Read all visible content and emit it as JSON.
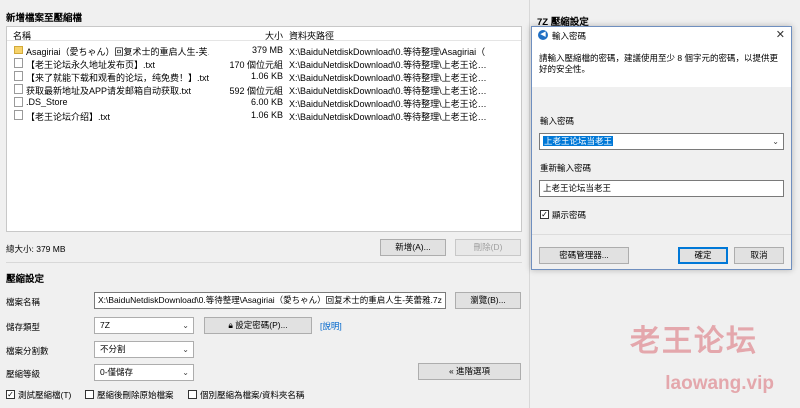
{
  "main": {
    "add_section_title": "新增檔案至壓縮檔",
    "columns": {
      "name": "名稱",
      "size": "大小",
      "path": "資料夾路徑"
    },
    "files": [
      {
        "name": "Asagiriai（愛ちゃん）回复术士的重启人生-芙…",
        "size": "379 MB",
        "path": "X:\\BaiduNetdiskDownload\\0.等待整理\\Asagiriai（",
        "icon": "folder-icon"
      },
      {
        "name": "【老王论坛永久地址发布页】.txt",
        "size": "170 個位元組",
        "path": "X:\\BaiduNetdiskDownload\\0.等待整理\\上老王论…",
        "icon": "file-icon"
      },
      {
        "name": "【来了就能下载和观看的论坛，纯免费！】.txt",
        "size": "1.06 KB",
        "path": "X:\\BaiduNetdiskDownload\\0.等待整理\\上老王论…",
        "icon": "file-icon"
      },
      {
        "name": "获取最新地址及APP请发邮箱自动获取.txt",
        "size": "592 個位元組",
        "path": "X:\\BaiduNetdiskDownload\\0.等待整理\\上老王论…",
        "icon": "file-icon"
      },
      {
        "name": ".DS_Store",
        "size": "6.00 KB",
        "path": "X:\\BaiduNetdiskDownload\\0.等待整理\\上老王论…",
        "icon": "file-icon"
      },
      {
        "name": "【老王论坛介绍】.txt",
        "size": "1.06 KB",
        "path": "X:\\BaiduNetdiskDownload\\0.等待整理\\上老王论…",
        "icon": "file-icon"
      }
    ],
    "total_size": "總大小: 379 MB",
    "add_button": "新增(A)...",
    "remove_button": "刪除(D)",
    "compress_section_title": "壓縮設定",
    "archive_name_label": "檔案名稱",
    "archive_name_value": "X:\\BaiduNetdiskDownload\\0.等待整理\\Asagiriai（愛ちゃん）回复术士的重启人生-芙蕾雅.7z",
    "browse_button": "瀏覽(B)...",
    "storage_type_label": "儲存類型",
    "storage_type_value": "7Z",
    "set_password_button": "設定密碼(P)...",
    "help_link": "[說明]",
    "split_label": "檔案分割數",
    "split_value": "不分割",
    "level_label": "壓縮等級",
    "level_value": "0-僅儲存",
    "advanced_button": "« 進階選項",
    "check_test": "測試壓縮檔(T)",
    "check_delete": "壓縮後刪除原始檔案",
    "check_separate": "個別壓縮為檔案/資料夾名稱",
    "checks_state": {
      "test": true,
      "delete": false,
      "separate": false
    }
  },
  "side_panel": {
    "title": "7Z 壓縮設定"
  },
  "dialog": {
    "title": "輸入密碼",
    "message": "請輸入壓縮檔的密碼，建議使用至少 8 個字元的密碼，以提供更好的安全性。",
    "password_label": "輸入密碼",
    "password_value": "上老王论坛当老王",
    "confirm_label": "重新輸入密碼",
    "confirm_value": "上老王论坛当老王",
    "show_password": "顯示密碼",
    "show_password_checked": true,
    "manager_button": "密碼管理器...",
    "ok_button": "確定",
    "cancel_button": "取消"
  },
  "watermark": {
    "cn": "老王论坛",
    "en": "laowang.vip"
  },
  "colors": {
    "accent": "#0078d7",
    "watermark": "#e4a7ac",
    "folder": "#f6d36b"
  }
}
